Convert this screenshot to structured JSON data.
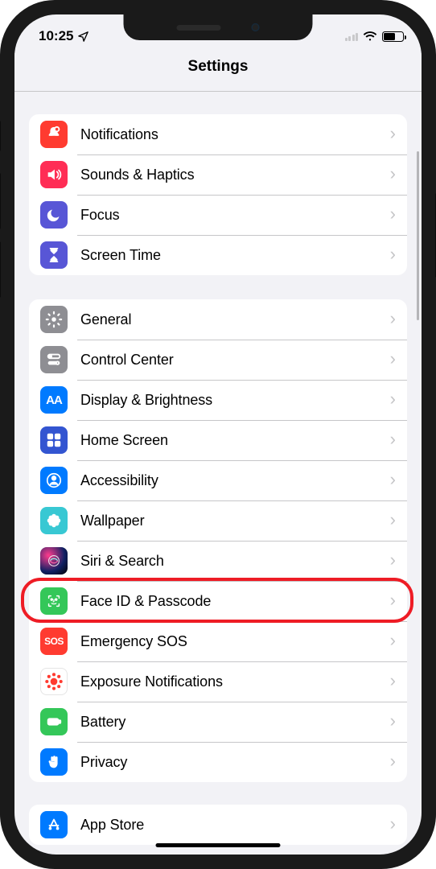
{
  "status": {
    "time": "10:25",
    "location_icon": "➤"
  },
  "header": {
    "title": "Settings"
  },
  "groups": [
    [
      {
        "id": "notifications",
        "label": "Notifications",
        "icon_color": "#ff3b30",
        "icon_name": "bell-icon"
      },
      {
        "id": "sounds-haptics",
        "label": "Sounds & Haptics",
        "icon_color": "#ff2d55",
        "icon_name": "speaker-icon"
      },
      {
        "id": "focus",
        "label": "Focus",
        "icon_color": "#5856d6",
        "icon_name": "moon-icon"
      },
      {
        "id": "screen-time",
        "label": "Screen Time",
        "icon_color": "#5856d6",
        "icon_name": "hourglass-icon"
      }
    ],
    [
      {
        "id": "general",
        "label": "General",
        "icon_color": "#8e8e93",
        "icon_name": "gear-icon"
      },
      {
        "id": "control-center",
        "label": "Control Center",
        "icon_color": "#8e8e93",
        "icon_name": "switches-icon"
      },
      {
        "id": "display-brightness",
        "label": "Display & Brightness",
        "icon_color": "#007aff",
        "icon_name": "text-size-icon"
      },
      {
        "id": "home-screen",
        "label": "Home Screen",
        "icon_color": "#3355d1",
        "icon_name": "grid-icon"
      },
      {
        "id": "accessibility",
        "label": "Accessibility",
        "icon_color": "#007aff",
        "icon_name": "person-circle-icon"
      },
      {
        "id": "wallpaper",
        "label": "Wallpaper",
        "icon_color": "#38c8d3",
        "icon_name": "flower-icon"
      },
      {
        "id": "siri-search",
        "label": "Siri & Search",
        "icon_color": "siri",
        "icon_name": "siri-icon"
      },
      {
        "id": "face-id-passcode",
        "label": "Face ID & Passcode",
        "icon_color": "#34c759",
        "icon_name": "face-id-icon",
        "highlight": true
      },
      {
        "id": "emergency-sos",
        "label": "Emergency SOS",
        "icon_color": "#ff3b30",
        "icon_name": "sos-icon",
        "icon_text": "SOS"
      },
      {
        "id": "exposure-notifications",
        "label": "Exposure Notifications",
        "icon_color": "exposure",
        "icon_name": "exposure-icon"
      },
      {
        "id": "battery",
        "label": "Battery",
        "icon_color": "#34c759",
        "icon_name": "battery-icon"
      },
      {
        "id": "privacy",
        "label": "Privacy",
        "icon_color": "#007aff",
        "icon_name": "hand-icon"
      }
    ],
    [
      {
        "id": "app-store",
        "label": "App Store",
        "icon_color": "#007aff",
        "icon_name": "appstore-icon"
      }
    ]
  ]
}
